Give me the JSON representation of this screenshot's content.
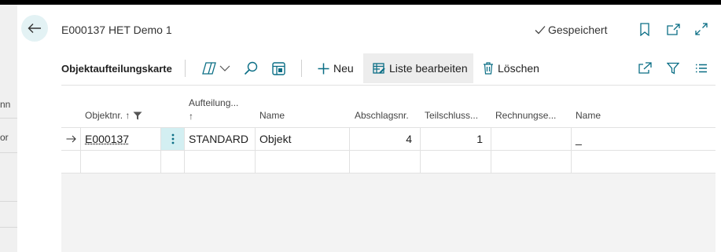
{
  "page": {
    "title": "E000137 HET Demo 1",
    "saved_status": "Gespeichert",
    "background_fragments": [
      "nn",
      "or"
    ]
  },
  "toolbar": {
    "page_name": "Objektaufteilungskarte",
    "new_label": "Neu",
    "edit_list_label": "Liste bearbeiten",
    "delete_label": "Löschen"
  },
  "table": {
    "columns": [
      {
        "label": "Objektnr. ↑",
        "line2": ""
      },
      {
        "label": "Aufteilung...",
        "line2": "↑"
      },
      {
        "label": "Name",
        "line2": ""
      },
      {
        "label": "Abschlagsnr.",
        "line2": ""
      },
      {
        "label": "Teilschluss...",
        "line2": ""
      },
      {
        "label": "Rechnungse...",
        "line2": ""
      },
      {
        "label": "Name",
        "line2": ""
      }
    ],
    "rows": [
      {
        "objektnr": "E000137",
        "aufteilung": "STANDARD",
        "name": "Objekt",
        "abschlagsnr": "4",
        "teilschluss": "1",
        "rechnungse": "",
        "name2": "_"
      }
    ]
  },
  "colors": {
    "accent": "#0a6e85",
    "back_button_bg": "#e3f2f4",
    "active_button_bg": "#ededed",
    "row_menu_bg": "#d3eff2"
  },
  "icons": [
    "back-arrow-icon",
    "checkmark-icon",
    "bookmark-icon",
    "open-new-window-icon",
    "expand-icon",
    "copilot-icon",
    "chevron-down-icon",
    "search-icon",
    "layout-icon",
    "plus-icon",
    "edit-list-icon",
    "trash-icon",
    "share-icon",
    "filter-icon",
    "list-view-icon",
    "row-arrow-icon",
    "more-options-icon"
  ]
}
